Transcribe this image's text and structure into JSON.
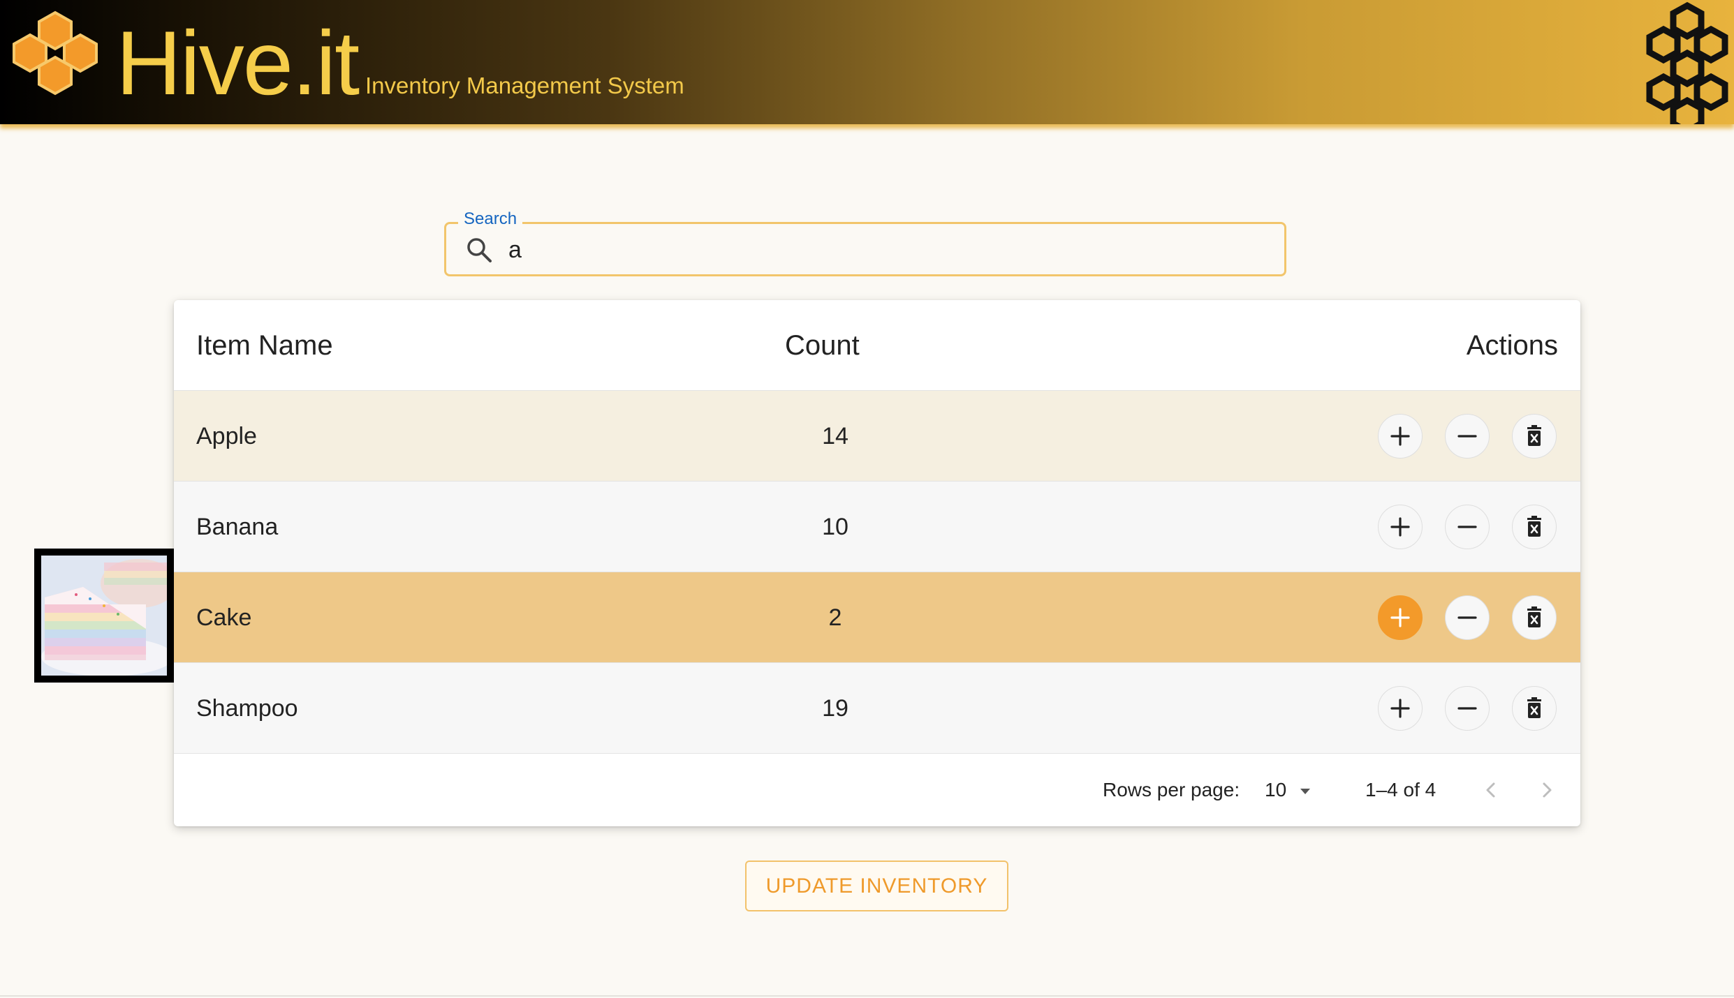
{
  "header": {
    "brand": "Hive.it",
    "tagline": "Inventory Management System"
  },
  "search": {
    "label": "Search",
    "value": "a"
  },
  "table": {
    "columns": {
      "name": "Item Name",
      "count": "Count",
      "actions": "Actions"
    },
    "rows": [
      {
        "name": "Apple",
        "count": "14"
      },
      {
        "name": "Banana",
        "count": "10"
      },
      {
        "name": "Cake",
        "count": "2"
      },
      {
        "name": "Shampoo",
        "count": "19"
      }
    ],
    "pagination": {
      "rows_per_page_label": "Rows per page:",
      "rows_per_page_value": "10",
      "range": "1–4 of 4"
    }
  },
  "update_button": {
    "label": "UPDATE INVENTORY"
  },
  "colors": {
    "accent": "#f39a2a",
    "highlight_row": "#eec888",
    "hover_row": "#f5efe0",
    "brand_text": "#f5cd4a",
    "search_label": "#1565c0"
  },
  "icons": [
    "honeycomb-logo-icon",
    "honeycomb-outline-icon",
    "search-icon",
    "plus-icon",
    "minus-icon",
    "trash-icon",
    "chevron-down-icon",
    "chevron-left-icon",
    "chevron-right-icon"
  ]
}
